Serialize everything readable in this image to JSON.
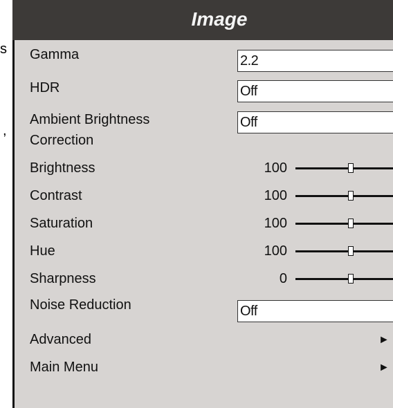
{
  "edge_glyphs": {
    "top": "s",
    "middle": ","
  },
  "menu": {
    "title": "Image",
    "gamma": {
      "label": "Gamma",
      "value": "2.2"
    },
    "hdr": {
      "label": "HDR",
      "value": "Off"
    },
    "ambient": {
      "label_line1": "Ambient Brightness",
      "label_line2": "Correction",
      "value": "Off"
    },
    "brightness": {
      "label": "Brightness",
      "value": "100",
      "level": 0.5
    },
    "contrast": {
      "label": "Contrast",
      "value": "100",
      "level": 0.5
    },
    "saturation": {
      "label": "Saturation",
      "value": "100",
      "level": 0.5
    },
    "hue": {
      "label": "Hue",
      "value": "100",
      "level": 0.5
    },
    "sharpness": {
      "label": "Sharpness",
      "value": "0",
      "level": 0.5
    },
    "noise_reduction": {
      "label": "Noise Reduction",
      "value": "Off"
    },
    "advanced": {
      "label": "Advanced",
      "arrow": "►"
    },
    "main_menu": {
      "label": "Main Menu",
      "arrow": "►"
    }
  },
  "colors": {
    "title_bar": "#3d3a38",
    "panel": "#d7d4d2",
    "title_text": "#f4f4f4"
  }
}
